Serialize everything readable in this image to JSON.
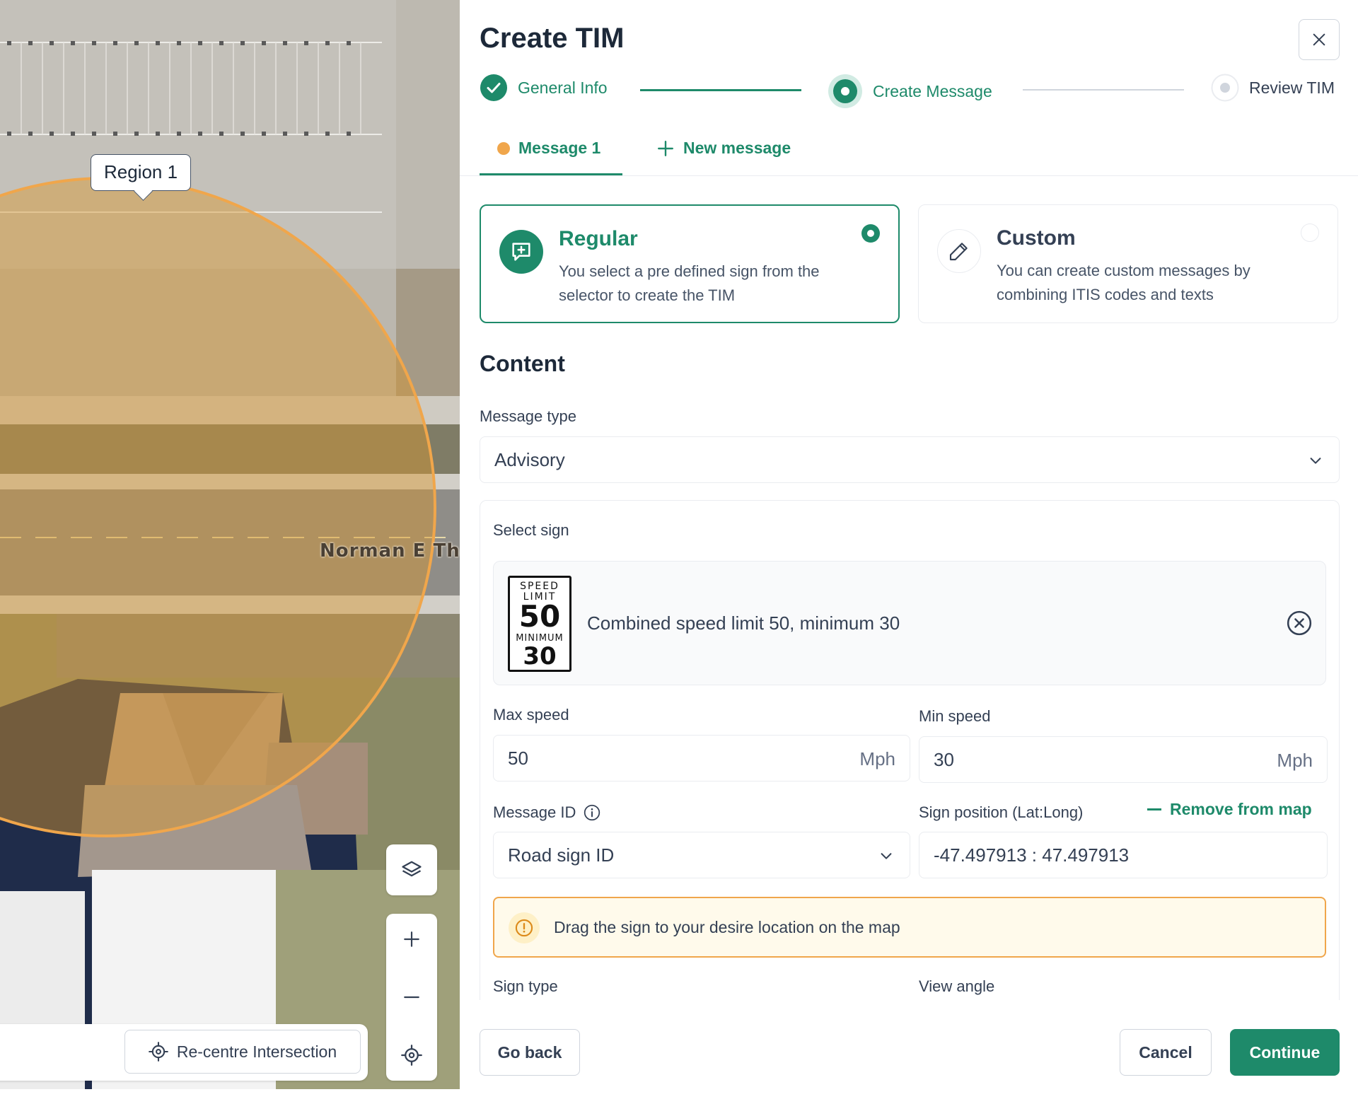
{
  "map": {
    "region_label": "Region 1",
    "street_label": "Norman E Tha",
    "recentre_label": "Re-centre Intersection",
    "region_color": "#f0a64b",
    "icons": [
      "layers-icon",
      "plus-icon",
      "minus-icon",
      "locate-icon",
      "crosshair-icon"
    ]
  },
  "panel": {
    "title": "Create TIM",
    "steps": [
      {
        "label": "General Info",
        "state": "complete"
      },
      {
        "label": "Create Message",
        "state": "current"
      },
      {
        "label": "Review TIM",
        "state": "upcoming"
      }
    ],
    "tabs": [
      {
        "label": "Message 1",
        "active": true
      },
      {
        "label": "New message",
        "active": false
      }
    ],
    "message_kinds": [
      {
        "title": "Regular",
        "description": "You select a pre defined sign from the selector to create the TIM",
        "selected": true
      },
      {
        "title": "Custom",
        "description": "You can create custom messages by combining ITIS codes and texts",
        "selected": false
      }
    ],
    "content_title": "Content",
    "message_type": {
      "label": "Message type",
      "value": "Advisory"
    },
    "select_sign": {
      "label": "Select sign",
      "selected_name": "Combined speed limit 50, minimum 30",
      "sign_text": {
        "line1": "SPEED",
        "line2": "LIMIT",
        "limit": "50",
        "line3": "MINIMUM",
        "minimum": "30"
      }
    },
    "max_speed": {
      "label": "Max speed",
      "value": "50",
      "unit": "Mph"
    },
    "min_speed": {
      "label": "Min speed",
      "value": "30",
      "unit": "Mph"
    },
    "message_id": {
      "label": "Message ID",
      "value": "Road sign ID"
    },
    "sign_position": {
      "label": "Sign position (Lat:Long)",
      "value": "-47.497913 : 47.497913",
      "remove_label": "Remove from map"
    },
    "alert_text": "Drag the sign to your desire location on the map",
    "sign_type_label": "Sign type",
    "view_angle_label": "View angle",
    "footer": {
      "go_back": "Go back",
      "cancel": "Cancel",
      "continue": "Continue"
    },
    "colors": {
      "primary": "#1e8a6a",
      "warning": "#f0a64b",
      "warning_bg": "#fffaeb"
    }
  }
}
